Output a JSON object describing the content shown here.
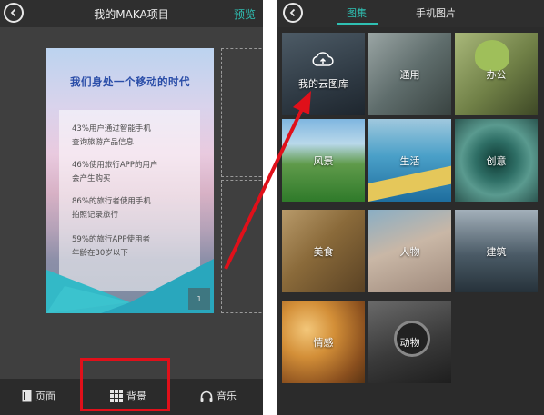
{
  "left": {
    "title": "我的MAKA项目",
    "preview_label": "预览",
    "card": {
      "title": "我们身处一个移动的时代",
      "stats": [
        {
          "line1": "43%用户通过智能手机",
          "line2": "查询旅游产品信息"
        },
        {
          "line1": "46%使用旅行APP的用户",
          "line2": "会产生购买"
        },
        {
          "line1": "86%的旅行者使用手机",
          "line2": "拍照记录旅行"
        },
        {
          "line1": "59%的旅行APP使用者",
          "line2": "年龄在30岁以下"
        }
      ],
      "page_number": "1"
    },
    "bottom_nav": [
      {
        "label": "页面",
        "icon": "page-icon"
      },
      {
        "label": "背景",
        "icon": "grid-icon"
      },
      {
        "label": "音乐",
        "icon": "headphones-icon"
      }
    ]
  },
  "right": {
    "tabs": [
      {
        "label": "图集",
        "active": true
      },
      {
        "label": "手机图片",
        "active": false
      }
    ],
    "categories": [
      {
        "label": "我的云图库",
        "icon": "cloud-upload-icon",
        "color": "#3a4652"
      },
      {
        "label": "通用",
        "color": "#6e7a78"
      },
      {
        "label": "办公",
        "color": "#7a8a50"
      },
      {
        "label": "风景",
        "color": "#3f8a3a"
      },
      {
        "label": "生活",
        "color": "#2b7fb0"
      },
      {
        "label": "创意",
        "color": "#2f6a62"
      },
      {
        "label": "美食",
        "color": "#8a6a3a"
      },
      {
        "label": "人物",
        "color": "#7a9ab0"
      },
      {
        "label": "建筑",
        "color": "#4a5a66"
      },
      {
        "label": "情感",
        "color": "#c07a2a"
      },
      {
        "label": "动物",
        "color": "#4a4a4a"
      }
    ]
  },
  "colors": {
    "accent": "#2fc0b3",
    "highlight_red": "#e0101a",
    "card_title": "#2a4da8"
  }
}
